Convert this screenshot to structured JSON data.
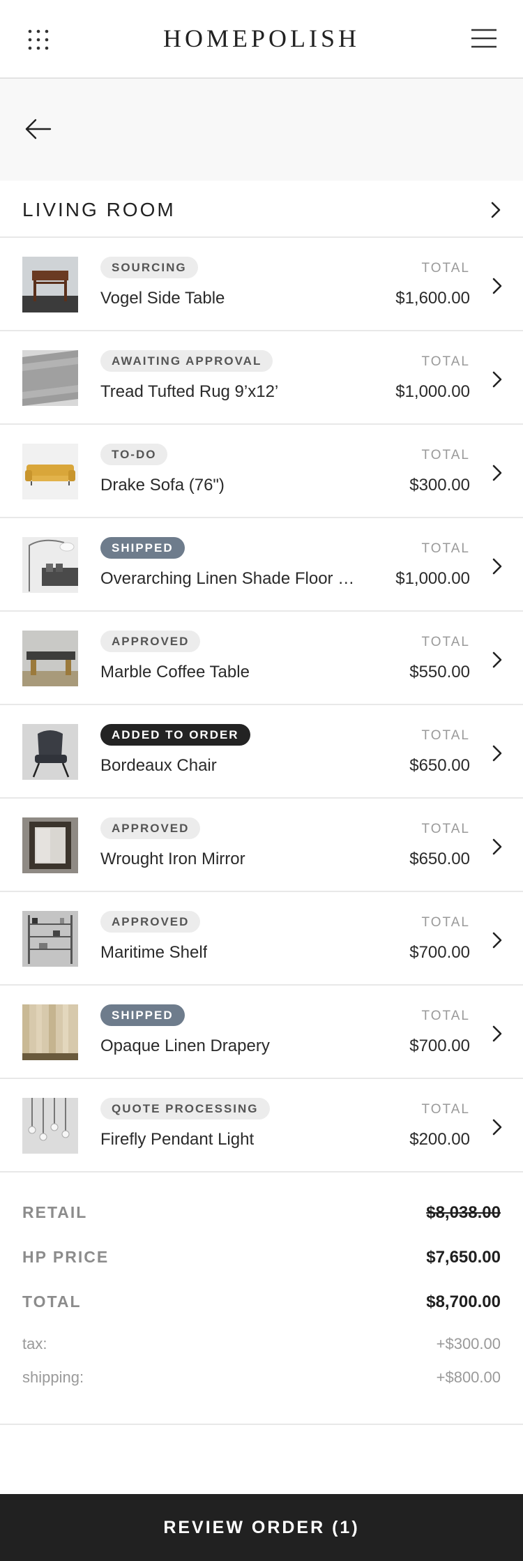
{
  "header": {
    "brand": "HOMEPOLISH",
    "apps_icon": "grid-dots-icon",
    "menu_icon": "hamburger-menu-icon"
  },
  "nav": {
    "back_icon": "arrow-left-icon"
  },
  "room": {
    "title": "LIVING ROOM",
    "chevron_icon": "chevron-right-icon"
  },
  "items": [
    {
      "status": "SOURCING",
      "status_style": "neutral",
      "name": "Vogel Side Table",
      "total_label": "TOTAL",
      "price": "$1,600.00",
      "thumb": "side-table"
    },
    {
      "status": "AWAITING APPROVAL",
      "status_style": "neutral",
      "name": "Tread Tufted Rug 9’x12’",
      "total_label": "TOTAL",
      "price": "$1,000.00",
      "thumb": "rug"
    },
    {
      "status": "TO-DO",
      "status_style": "neutral",
      "name": "Drake Sofa (76\")",
      "total_label": "TOTAL",
      "price": "$300.00",
      "thumb": "sofa"
    },
    {
      "status": "SHIPPED",
      "status_style": "shipped",
      "name": "Overarching Linen Shade Floor Lamp",
      "total_label": "TOTAL",
      "price": "$1,000.00",
      "thumb": "floor-lamp"
    },
    {
      "status": "APPROVED",
      "status_style": "neutral",
      "name": "Marble Coffee Table",
      "total_label": "TOTAL",
      "price": "$550.00",
      "thumb": "coffee-table"
    },
    {
      "status": "ADDED TO ORDER",
      "status_style": "added",
      "name": "Bordeaux Chair",
      "total_label": "TOTAL",
      "price": "$650.00",
      "thumb": "chair"
    },
    {
      "status": "APPROVED",
      "status_style": "neutral",
      "name": "Wrought Iron Mirror",
      "total_label": "TOTAL",
      "price": "$650.00",
      "thumb": "mirror"
    },
    {
      "status": "APPROVED",
      "status_style": "neutral",
      "name": "Maritime Shelf",
      "total_label": "TOTAL",
      "price": "$700.00",
      "thumb": "shelf"
    },
    {
      "status": "SHIPPED",
      "status_style": "shipped",
      "name": "Opaque Linen Drapery",
      "total_label": "TOTAL",
      "price": "$700.00",
      "thumb": "drapery"
    },
    {
      "status": "QUOTE PROCESSING",
      "status_style": "neutral",
      "name": "Firefly Pendant Light",
      "total_label": "TOTAL",
      "price": "$200.00",
      "thumb": "pendant-light"
    }
  ],
  "summary": {
    "retail_label": "RETAIL",
    "retail_value": "$8,038.00",
    "hp_label": "HP PRICE",
    "hp_value": "$7,650.00",
    "total_label": "TOTAL",
    "total_value": "$8,700.00",
    "tax_label": "tax:",
    "tax_value": "+$300.00",
    "shipping_label": "shipping:",
    "shipping_value": "+$800.00"
  },
  "cta": {
    "label": "REVIEW ORDER (1)"
  },
  "colors": {
    "badge_neutral": "#ececec",
    "badge_shipped": "#6e7c8c",
    "badge_added": "#232323",
    "cta_background": "#212121"
  }
}
